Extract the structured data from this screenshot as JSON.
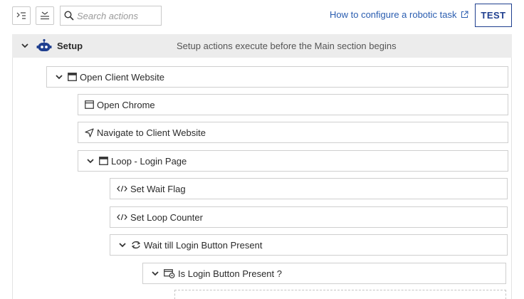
{
  "toolbar": {
    "expand_all_icon": "expand-all-icon",
    "collapse_all_icon": "collapse-all-icon",
    "search_placeholder": "Search actions",
    "help_link_label": "How to configure a robotic task",
    "test_label": "TEST"
  },
  "setup": {
    "title": "Setup",
    "description": "Setup actions execute before the Main section begins"
  },
  "actions": [
    {
      "label": "Open Client Website",
      "icon": "window-icon"
    },
    {
      "label": "Open Chrome",
      "icon": "window-outline-icon"
    },
    {
      "label": "Navigate to Client Website",
      "icon": "navigate-arrow-icon"
    },
    {
      "label": "Loop - Login Page",
      "icon": "window-icon"
    },
    {
      "label": "Set Wait Flag",
      "icon": "code-icon"
    },
    {
      "label": "Set Loop Counter",
      "icon": "code-icon"
    },
    {
      "label": "Wait till Login Button Present",
      "icon": "loop-icon"
    },
    {
      "label": "Is Login Button Present ?",
      "icon": "condition-icon"
    }
  ],
  "colors": {
    "link": "#2a5db0",
    "test_button": "#1f3f8f",
    "setup_bar": "#ececec",
    "bot_icon": "#1f3f8f"
  }
}
